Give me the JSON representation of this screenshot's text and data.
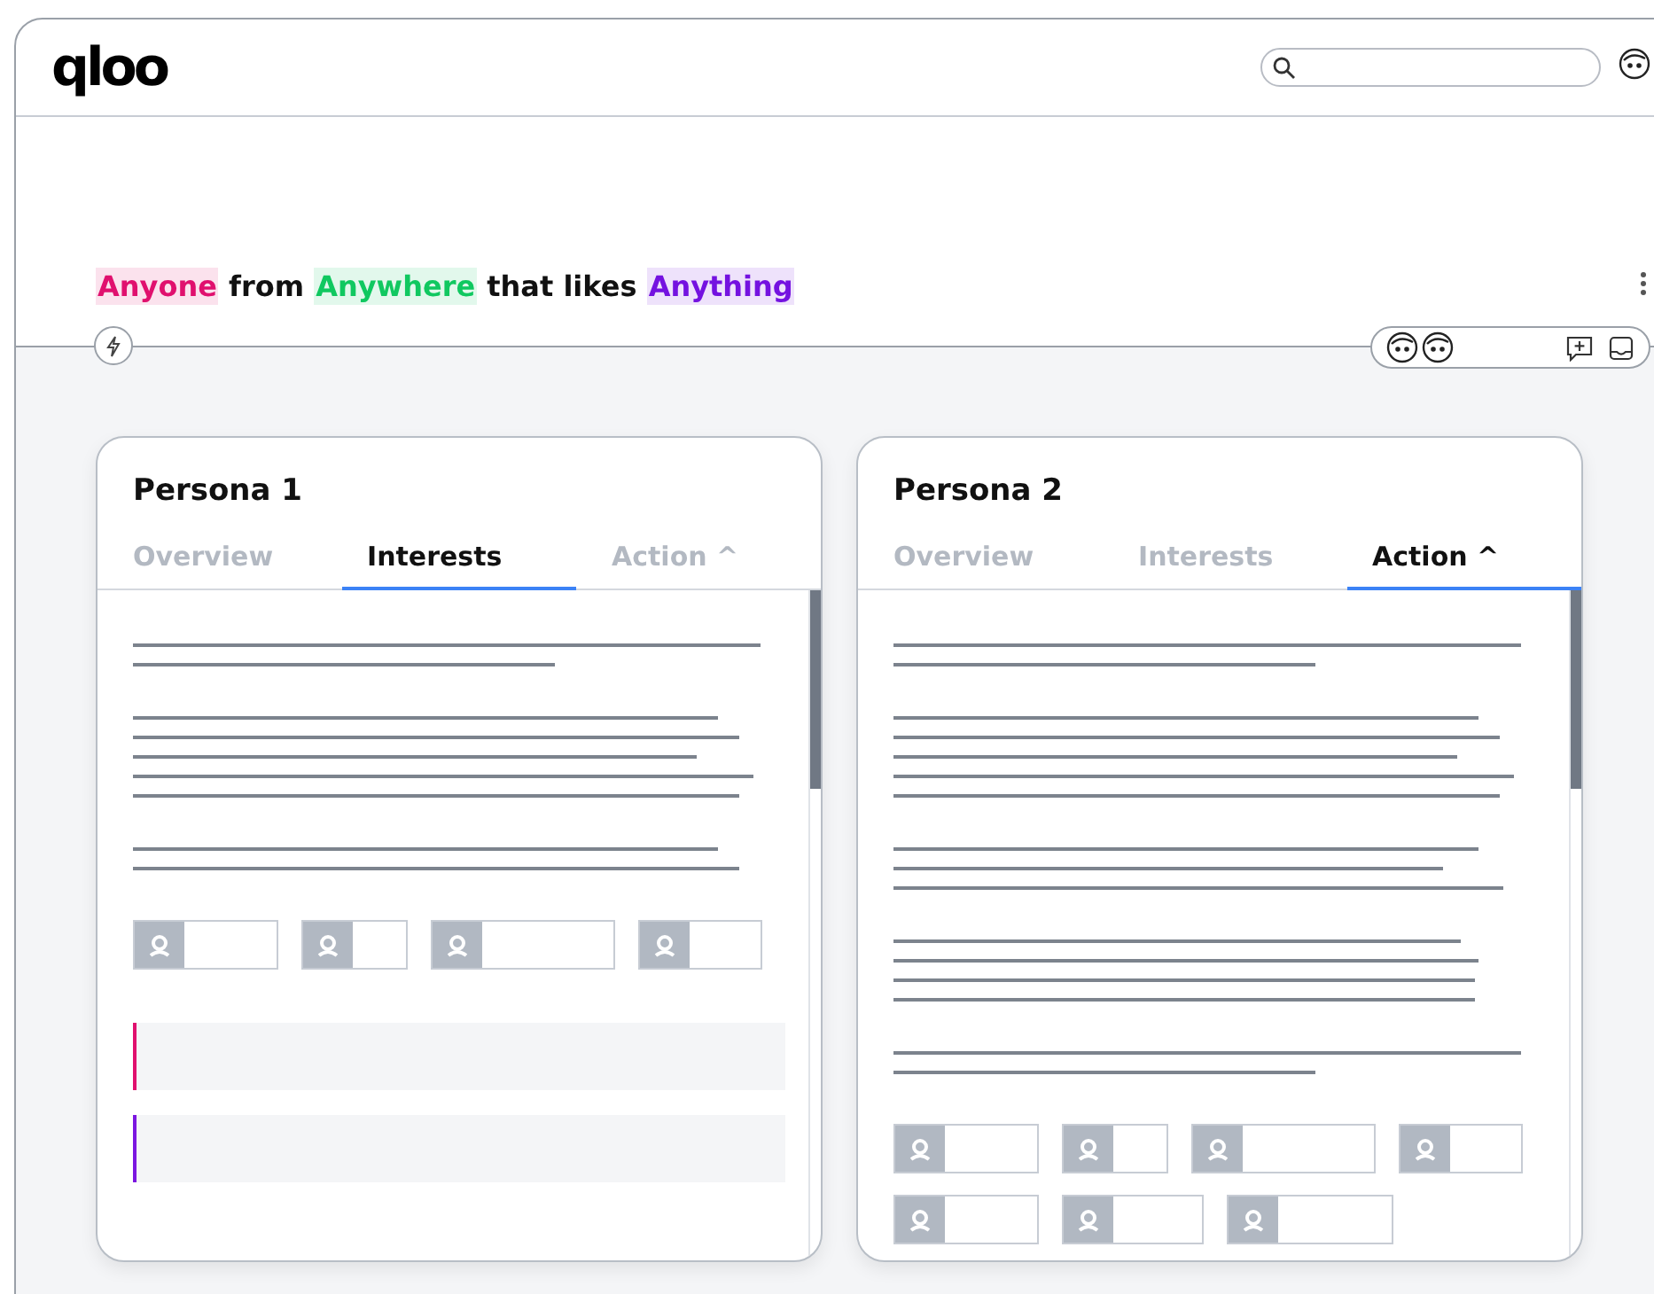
{
  "logo": "qloo",
  "headline": [
    {
      "text": "Anyone",
      "color": "#e0106e"
    },
    {
      "text": " from "
    },
    {
      "text": "Anywhere",
      "color": "#10c860"
    },
    {
      "text": " that likes "
    },
    {
      "text": "Anything",
      "color": "#7412e0"
    }
  ],
  "cards": [
    {
      "title": "Persona 1",
      "tabs": [
        {
          "label": "Overview",
          "selected": false
        },
        {
          "label": "Interests",
          "selected": true
        },
        {
          "label": "Action ^",
          "selected": false
        }
      ],
      "sections": [
        {
          "kind": "text"
        },
        {
          "kind": "text"
        },
        {
          "kind": "text"
        },
        {
          "kind": "tags"
        },
        {
          "kind": "note",
          "color": "#e0106e"
        },
        {
          "kind": "note",
          "color": "#7b16e0"
        }
      ]
    },
    {
      "title": "Persona 2",
      "tabs": [
        {
          "label": "Overview",
          "selected": false
        },
        {
          "label": "Interests",
          "selected": false
        },
        {
          "label": "Action ^",
          "selected": true
        }
      ],
      "sections": [
        {
          "kind": "text"
        },
        {
          "kind": "text"
        },
        {
          "kind": "text"
        },
        {
          "kind": "text"
        },
        {
          "kind": "text"
        },
        {
          "kind": "tags"
        }
      ]
    }
  ]
}
